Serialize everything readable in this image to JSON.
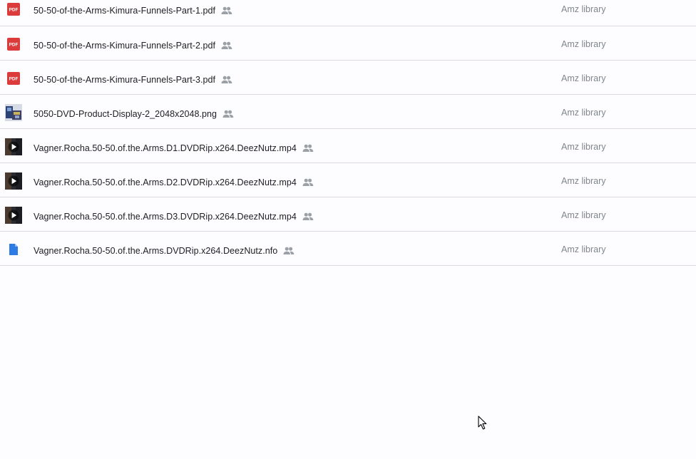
{
  "files": [
    {
      "name": "50-50-of-the-Arms-Kimura-Funnels-Part-1.pdf",
      "type": "pdf",
      "icon": "pdf-file-icon",
      "owner": "Amz library",
      "shared": true
    },
    {
      "name": "50-50-of-the-Arms-Kimura-Funnels-Part-2.pdf",
      "type": "pdf",
      "icon": "pdf-file-icon",
      "owner": "Amz library",
      "shared": true
    },
    {
      "name": "50-50-of-the-Arms-Kimura-Funnels-Part-3.pdf",
      "type": "pdf",
      "icon": "pdf-file-icon",
      "owner": "Amz library",
      "shared": true
    },
    {
      "name": "5050-DVD-Product-Display-2_2048x2048.png",
      "type": "image",
      "icon": "image-thumbnail-icon",
      "owner": "Amz library",
      "shared": true
    },
    {
      "name": "Vagner.Rocha.50-50.of.the.Arms.D1.DVDRip.x264.DeezNutz.mp4",
      "type": "video",
      "icon": "video-thumbnail-icon",
      "owner": "Amz library",
      "shared": true
    },
    {
      "name": "Vagner.Rocha.50-50.of.the.Arms.D2.DVDRip.x264.DeezNutz.mp4",
      "type": "video",
      "icon": "video-thumbnail-icon",
      "owner": "Amz library",
      "shared": true
    },
    {
      "name": "Vagner.Rocha.50-50.of.the.Arms.D3.DVDRip.x264.DeezNutz.mp4",
      "type": "video",
      "icon": "video-thumbnail-icon",
      "owner": "Amz library",
      "shared": true
    },
    {
      "name": "Vagner.Rocha.50-50.of.the.Arms.DVDRip.x264.DeezNutz.nfo",
      "type": "doc",
      "icon": "document-file-icon",
      "owner": "Amz library",
      "shared": true
    }
  ],
  "icons": {
    "pdf_label": "PDF",
    "shared_icon": "people-icon",
    "cursor_icon": "mouse-pointer-icon"
  },
  "colors": {
    "pdf_red": "#db3b3b",
    "doc_blue": "#2d7be5",
    "divider": "#dadce0",
    "owner_text": "#80868b",
    "name_text": "#202124"
  }
}
